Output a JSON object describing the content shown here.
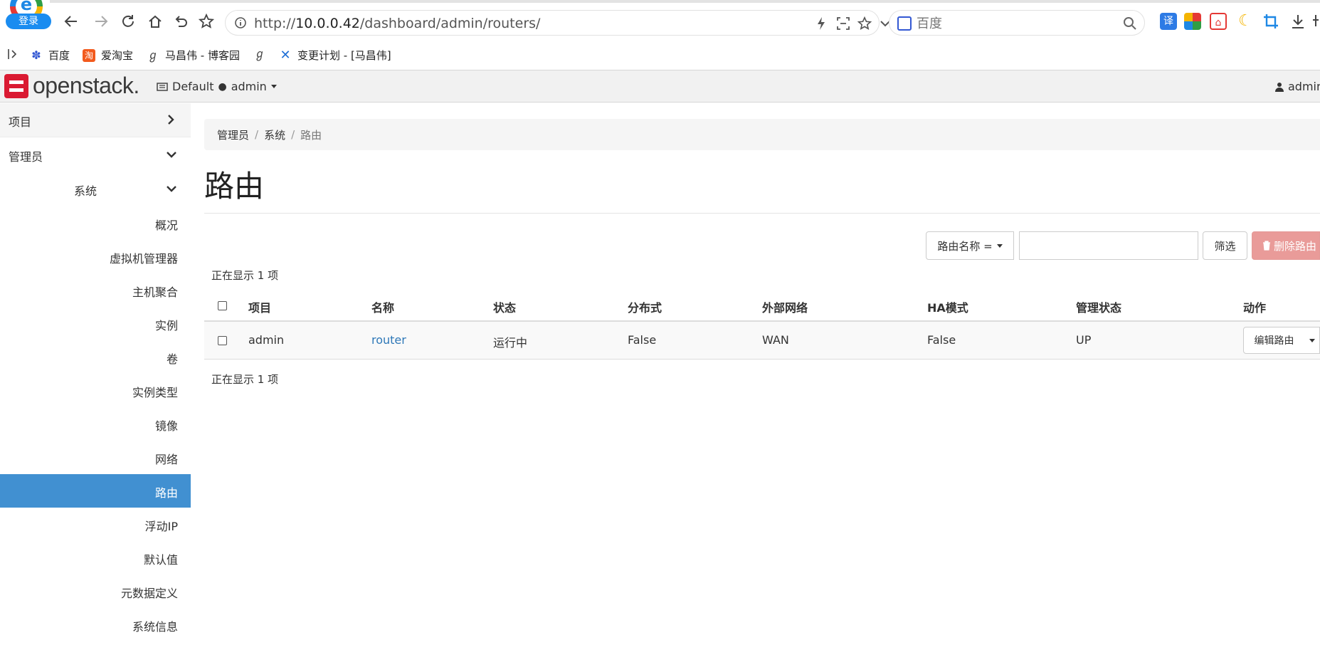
{
  "browser": {
    "login_badge": "登录",
    "url_protocol": "http://",
    "url_host": "10.0.0.42",
    "url_path": "/dashboard/admin/routers/",
    "search_placeholder": "百度",
    "ext_translate": "译"
  },
  "bookmarks": {
    "items": [
      {
        "label": "百度",
        "icon": "baidu-paw-icon"
      },
      {
        "label": "爱淘宝",
        "icon": "taobao-icon"
      },
      {
        "label": "马昌伟 - 博客园",
        "icon": "cnblogs-icon"
      },
      {
        "label": "",
        "icon": "cnblogs-icon"
      },
      {
        "label": "变更计划 - [马昌伟]",
        "icon": "confluence-icon"
      }
    ]
  },
  "header": {
    "brand": "openstack.",
    "domain": "Default",
    "project": "admin",
    "user": "admin"
  },
  "sidebar": {
    "project": "项目",
    "admin": "管理员",
    "system": "系统",
    "items": [
      "概况",
      "虚拟机管理器",
      "主机聚合",
      "实例",
      "卷",
      "实例类型",
      "镜像",
      "网络",
      "路由",
      "浮动IP",
      "默认值",
      "元数据定义",
      "系统信息"
    ],
    "active_item": "路由"
  },
  "breadcrumb": {
    "items": [
      "管理员",
      "系统",
      "路由"
    ]
  },
  "page": {
    "title": "路由"
  },
  "filter": {
    "select_label": "路由名称 =",
    "input_value": "",
    "button_label": "筛选",
    "delete_label": "删除路由"
  },
  "table": {
    "count_text": "正在显示 1 项",
    "columns": [
      "项目",
      "名称",
      "状态",
      "分布式",
      "外部网络",
      "HA模式",
      "管理状态",
      "动作"
    ],
    "rows": [
      {
        "project": "admin",
        "name": "router",
        "status": "运行中",
        "distributed": "False",
        "external_network": "WAN",
        "ha_mode": "False",
        "admin_state": "UP",
        "action": "编辑路由"
      }
    ]
  }
}
